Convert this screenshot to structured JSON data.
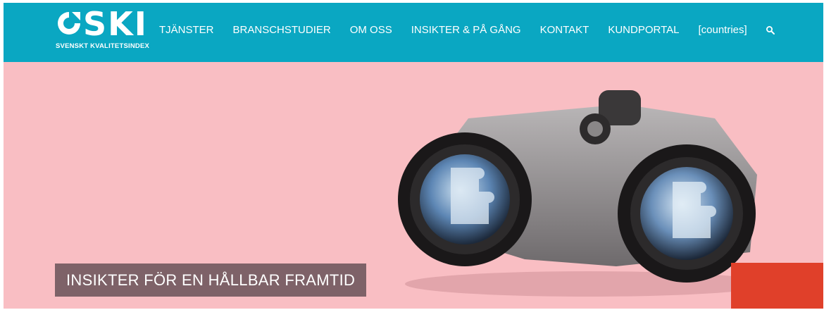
{
  "brand": {
    "logo_word": "SKI",
    "logo_tagline": "SVENSKT KVALITETSINDEX"
  },
  "nav": {
    "items": [
      {
        "label": "TJÄNSTER"
      },
      {
        "label": "BRANSCHSTUDIER"
      },
      {
        "label": "OM OSS"
      },
      {
        "label": "INSIKTER & PÅ GÅNG"
      },
      {
        "label": "KONTAKT"
      },
      {
        "label": "KUNDPORTAL"
      },
      {
        "label": "[countries]"
      }
    ],
    "search_icon": "search-icon"
  },
  "hero": {
    "caption": "INSIKTER FÖR EN HÅLLBAR FRAMTID",
    "image": "binoculars-with-puzzle-reflection"
  },
  "colors": {
    "nav_bg": "#0aa7c2",
    "hero_bg": "#f9bec3",
    "caption_bg": "#7e6268",
    "accent": "#e0402a"
  }
}
